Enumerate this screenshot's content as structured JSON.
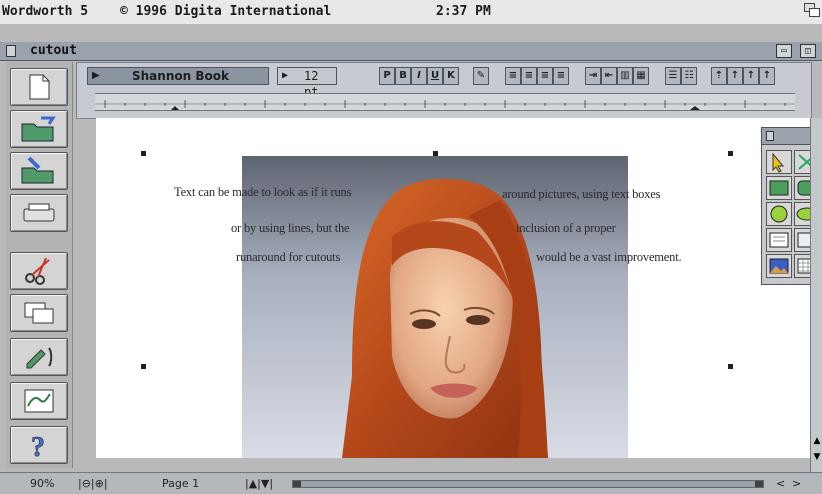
{
  "app": {
    "title": "Wordworth 5",
    "copyright": "© 1996 Digita International",
    "clock": "2:37 PM"
  },
  "window": {
    "title": "cutout"
  },
  "toolbar": {
    "font_name": "Shannon Book",
    "font_size": "12 pt",
    "style_buttons": [
      "P",
      "B",
      "I",
      "U",
      "K"
    ]
  },
  "document": {
    "lines": [
      {
        "left": "Text can be made to look as if it runs",
        "right": "around pictures, using text boxes"
      },
      {
        "left": "or by using lines, but the",
        "right": "inclusion of a proper"
      },
      {
        "left": "runaround for cutouts",
        "right": "would be a vast improvement."
      }
    ]
  },
  "status": {
    "zoom": "90%",
    "page": "Page 1"
  },
  "icons": {
    "toolbox": [
      "new-document-icon",
      "open-folder-icon",
      "save-folder-icon",
      "print-icon",
      "scissors-icon",
      "frames-icon",
      "pen-icon",
      "picture-icon",
      "help-icon"
    ]
  }
}
